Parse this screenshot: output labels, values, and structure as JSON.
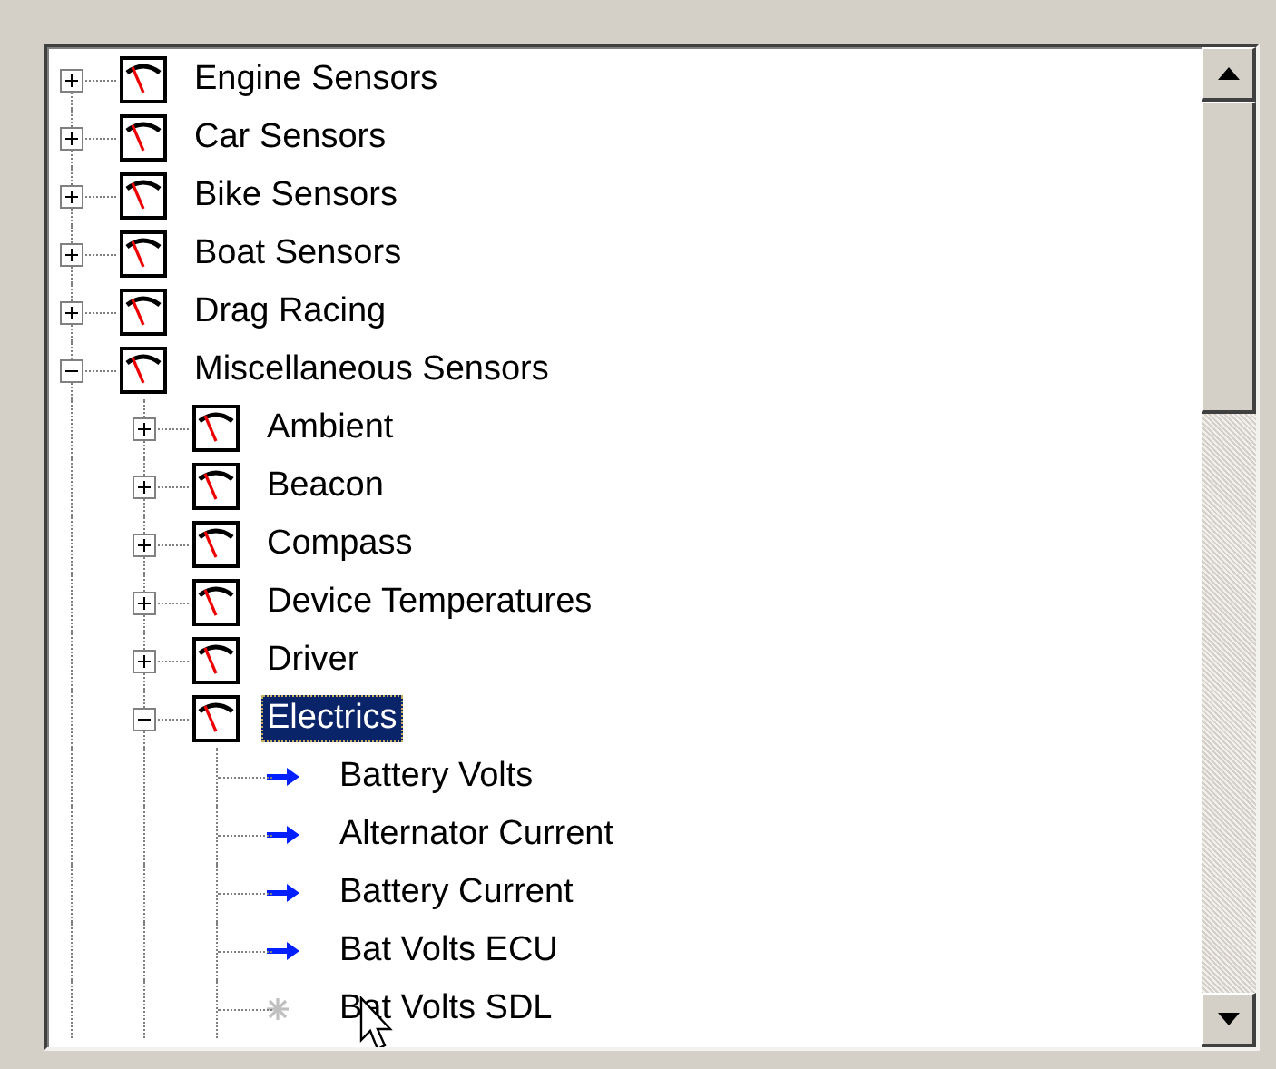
{
  "tree": [
    {
      "label": "Engine Sensors",
      "kind": "gauge",
      "expanded": false,
      "selected": false
    },
    {
      "label": "Car Sensors",
      "kind": "gauge",
      "expanded": false,
      "selected": false
    },
    {
      "label": "Bike Sensors",
      "kind": "gauge",
      "expanded": false,
      "selected": false
    },
    {
      "label": "Boat Sensors",
      "kind": "gauge",
      "expanded": false,
      "selected": false
    },
    {
      "label": "Drag Racing",
      "kind": "gauge",
      "expanded": false,
      "selected": false
    },
    {
      "label": "Miscellaneous Sensors",
      "kind": "gauge",
      "expanded": true,
      "selected": false,
      "children": [
        {
          "label": "Ambient",
          "kind": "gauge",
          "expanded": false,
          "selected": false
        },
        {
          "label": "Beacon",
          "kind": "gauge",
          "expanded": false,
          "selected": false
        },
        {
          "label": "Compass",
          "kind": "gauge",
          "expanded": false,
          "selected": false
        },
        {
          "label": "Device Temperatures",
          "kind": "gauge",
          "expanded": false,
          "selected": false
        },
        {
          "label": "Driver",
          "kind": "gauge",
          "expanded": false,
          "selected": false
        },
        {
          "label": "Electrics",
          "kind": "gauge",
          "expanded": true,
          "selected": true,
          "children": [
            {
              "label": "Battery Volts",
              "kind": "arrow",
              "selected": false
            },
            {
              "label": "Alternator Current",
              "kind": "arrow",
              "selected": false
            },
            {
              "label": "Battery Current",
              "kind": "arrow",
              "selected": false
            },
            {
              "label": "Bat Volts ECU",
              "kind": "arrow",
              "selected": false
            },
            {
              "label": "Bat Volts SDL",
              "kind": "star",
              "selected": false
            }
          ]
        }
      ]
    }
  ]
}
